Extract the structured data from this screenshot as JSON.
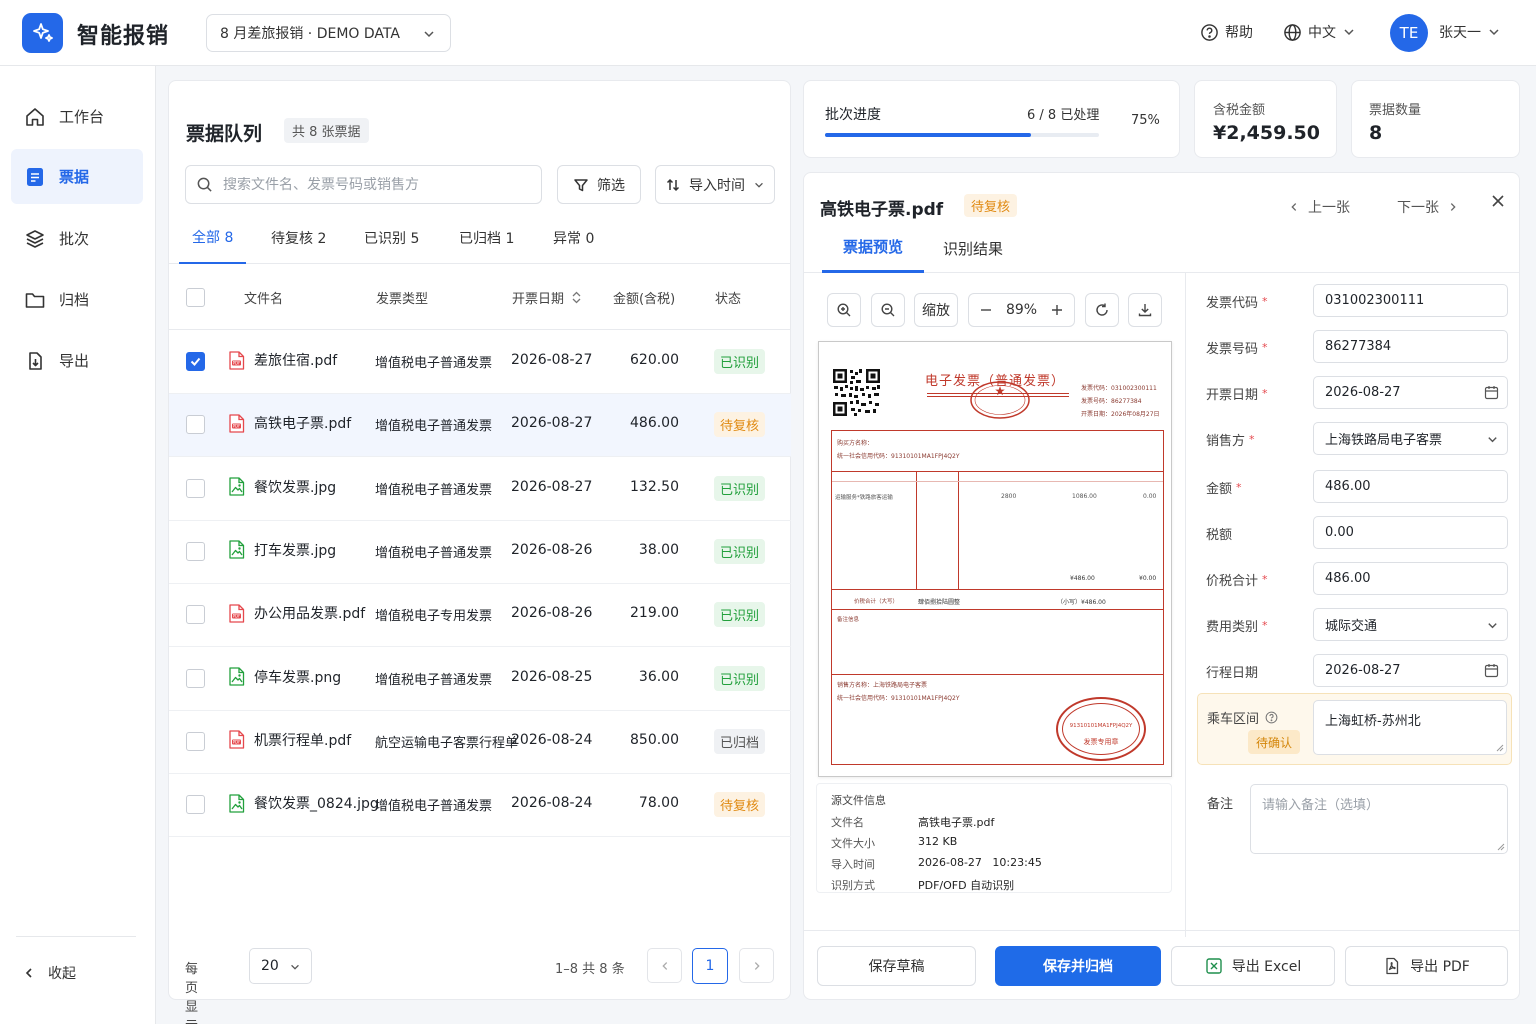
{
  "app": {
    "title": "智能报销"
  },
  "batch": {
    "label": "8 月差旅报销 · DEMO DATA"
  },
  "topbar": {
    "help": "帮助",
    "language": "中文",
    "avatar_initials": "TE",
    "user_name": "张天一"
  },
  "sidebar": {
    "items": [
      {
        "label": "工作台",
        "icon": "home-icon"
      },
      {
        "label": "票据",
        "icon": "document-icon",
        "active": true
      },
      {
        "label": "批次",
        "icon": "layers-icon"
      },
      {
        "label": "归档",
        "icon": "folder-icon"
      },
      {
        "label": "导出",
        "icon": "export-icon"
      }
    ],
    "collapse": "收起"
  },
  "queue": {
    "title": "票据队列",
    "count": "共 8 张票据",
    "search_placeholder": "搜索文件名、发票号码或销售方",
    "filter": "筛选",
    "sort": "导入时间",
    "tabs": [
      "全部 8",
      "待复核 2",
      "已识别 5",
      "已归档 1",
      "异常 0"
    ],
    "columns": [
      "文件名",
      "发票类型",
      "开票日期",
      "金额(含税)",
      "状态"
    ],
    "rows": [
      {
        "name": "差旅住宿.pdf",
        "kind": "pdf",
        "type": "增值税电子普通发票",
        "date": "2026-08-27",
        "amount": "620.00",
        "status": "已识别",
        "checked": true
      },
      {
        "name": "高铁电子票.pdf",
        "kind": "pdf",
        "type": "增值税电子普通发票",
        "date": "2026-08-27",
        "amount": "486.00",
        "status": "待复核",
        "selected": true
      },
      {
        "name": "餐饮发票.jpg",
        "kind": "img",
        "type": "增值税电子普通发票",
        "date": "2026-08-27",
        "amount": "132.50",
        "status": "已识别"
      },
      {
        "name": "打车发票.jpg",
        "kind": "img",
        "type": "增值税电子普通发票",
        "date": "2026-08-26",
        "amount": "38.00",
        "status": "已识别"
      },
      {
        "name": "办公用品发票.pdf",
        "kind": "pdf",
        "type": "增值税电子专用发票",
        "date": "2026-08-26",
        "amount": "219.00",
        "status": "已识别"
      },
      {
        "name": "停车发票.png",
        "kind": "img",
        "type": "增值税电子普通发票",
        "date": "2026-08-25",
        "amount": "36.00",
        "status": "已识别"
      },
      {
        "name": "机票行程单.pdf",
        "kind": "pdf",
        "type": "航空运输电子客票行程单",
        "date": "2026-08-24",
        "amount": "850.00",
        "status": "已归档"
      },
      {
        "name": "餐饮发票_0824.jpg",
        "kind": "img",
        "type": "增值税电子普通发票",
        "date": "2026-08-24",
        "amount": "78.00",
        "status": "待复核"
      }
    ],
    "pager": {
      "per_page_label": "每页显示",
      "per_page": "20",
      "range": "1–8 共 8 条",
      "page": "1"
    }
  },
  "stats": {
    "progress_label": "批次进度",
    "progress_text": "6 / 8 已处理",
    "progress_pct": "75%",
    "progress_value": 0.75,
    "amount_label": "含税金额",
    "amount": "¥2,459.50",
    "count_label": "票据数量",
    "count": "8"
  },
  "detail": {
    "title": "高铁电子票.pdf",
    "badge": "待复核",
    "prev": "上一张",
    "next": "下一张",
    "tabs": [
      "票据预览",
      "识别结果"
    ],
    "zoom_label": "缩放",
    "zoom": "89%",
    "invoice": {
      "heading": "电子发票（普通发票）",
      "code_line": "发票代码：031002300111",
      "number_line": "发票号码：86277384",
      "date_line": "开票日期：2026年08月27日",
      "buyer_name": "购买方名称：",
      "buyer_tax": "统一社会信用代码：91310101MA1FPJ4Q2Y",
      "item_name": "运输服务*铁路旅客运输",
      "qty": "2800",
      "price": "1086.00",
      "tax": "0.00",
      "subtotal": "¥486.00",
      "subtotal_tax": "¥0.00",
      "total_label": "价税合计（大写）",
      "total_words": "肆佰捌拾陆圆整",
      "total_small": "（小写）¥486.00",
      "remark_label": "备注信息",
      "seller_name": "销售方名称：上海铁路局电子客票",
      "seller_tax": "统一社会信用代码：91310101MA1FPJ4Q2Y",
      "seal_text": "发票专用章",
      "stamp_text": "91310101MA1FPJ4Q2Y"
    },
    "source": {
      "title": "源文件信息",
      "rows": [
        {
          "k": "文件名",
          "v": "高铁电子票.pdf"
        },
        {
          "k": "文件大小",
          "v": "312 KB"
        },
        {
          "k": "导入时间",
          "v": "2026-08-27   10:23:45"
        },
        {
          "k": "识别方式",
          "v": "PDF/OFD 自动识别"
        }
      ]
    },
    "fields": [
      {
        "label": "发票代码",
        "value": "031002300111",
        "req": true
      },
      {
        "label": "发票号码",
        "value": "86277384",
        "req": true
      },
      {
        "label": "开票日期",
        "value": "2026-08-27",
        "req": true,
        "icon": "calendar-icon"
      },
      {
        "label": "销售方",
        "value": "上海铁路局电子客票",
        "req": true,
        "icon": "chevron-down-icon"
      },
      {
        "label": "金额",
        "value": "486.00",
        "req": true
      },
      {
        "label": "税额",
        "value": "0.00",
        "req": false
      },
      {
        "label": "价税合计",
        "value": "486.00",
        "req": true
      },
      {
        "label": "费用类别",
        "value": "城际交通",
        "req": true,
        "icon": "chevron-down-icon"
      },
      {
        "label": "行程日期",
        "value": "2026-08-27",
        "req": false,
        "icon": "calendar-icon"
      }
    ],
    "route": {
      "label": "乘车区间",
      "badge": "待确认",
      "value": "上海虹桥-苏州北"
    },
    "note": {
      "label": "备注",
      "placeholder": "请输入备注（选填）"
    },
    "buttons": {
      "draft": "保存草稿",
      "save": "保存并归档",
      "excel": "导出 Excel",
      "pdf": "导出 PDF"
    }
  },
  "colors": {
    "primary": "#2468e8",
    "success": "#22a03c",
    "warning": "#e08a12",
    "invoice_red": "#c0392b"
  }
}
